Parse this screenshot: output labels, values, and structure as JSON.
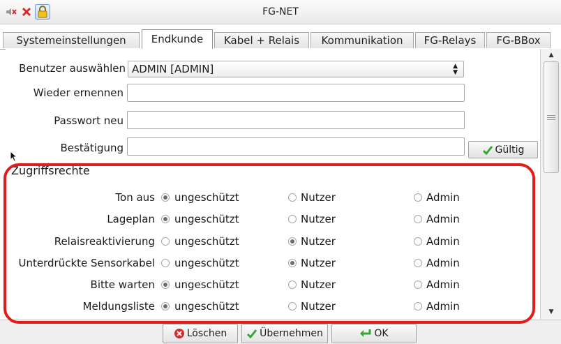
{
  "window": {
    "title": "FG-NET"
  },
  "titlebar_icons": [
    "speaker-muted-icon",
    "close-x-icon",
    "lock-icon"
  ],
  "tabs": [
    "Systemeinstellungen",
    "Endkunde",
    "Kabel + Relais",
    "Kommunikation",
    "FG-Relays",
    "FG-BBox"
  ],
  "active_tab": "Endkunde",
  "form": {
    "user_label": "Benutzer auswählen",
    "user_value": "ADMIN [ADMIN]",
    "rename_label": "Wieder ernennen",
    "rename_value": "",
    "password_label": "Passwort neu",
    "password_value": "",
    "confirm_label": "Bestätigung",
    "confirm_value": "",
    "valid_button": "Gültig"
  },
  "access": {
    "title": "Zugriffsrechte",
    "options": [
      "ungeschützt",
      "Nutzer",
      "Admin"
    ],
    "rows": [
      {
        "label": "Ton aus",
        "selected": "ungeschützt"
      },
      {
        "label": "Lageplan",
        "selected": "ungeschützt"
      },
      {
        "label": "Relaisreaktivierung",
        "selected": "Nutzer"
      },
      {
        "label": "Unterdrückte Sensorkabel",
        "selected": "Nutzer"
      },
      {
        "label": "Bitte warten",
        "selected": "ungeschützt"
      },
      {
        "label": "Meldungsliste",
        "selected": "ungeschützt"
      }
    ]
  },
  "buttons": {
    "delete": "Löschen",
    "apply": "Übernehmen",
    "ok": "OK"
  },
  "colors": {
    "highlight": "#e21b1b",
    "check_green": "#3aa33a",
    "delete_red": "#d62a2a"
  }
}
